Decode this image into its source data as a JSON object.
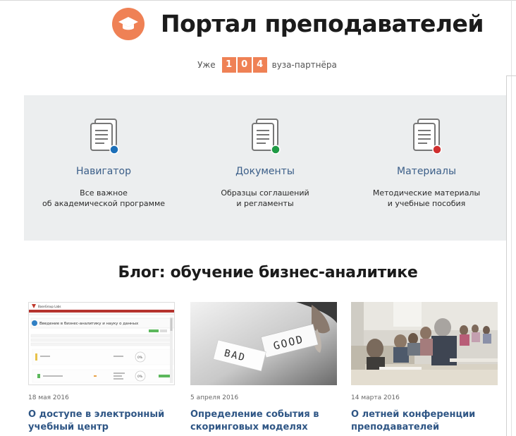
{
  "header": {
    "logo_icon": "graduation-cap-icon",
    "title": "Портал преподавателей",
    "accent_color": "#ef8155"
  },
  "counter": {
    "prefix": "Уже",
    "digits": [
      "1",
      "0",
      "4"
    ],
    "suffix": "вуза-партнёра"
  },
  "features": [
    {
      "icon": "document-icon",
      "dot_color": "#1c6fb8",
      "title": "Навигатор",
      "desc_line1": "Все важное",
      "desc_line2": "об академической программе"
    },
    {
      "icon": "document-icon",
      "dot_color": "#1f9a45",
      "title": "Документы",
      "desc_line1": "Образцы соглашений",
      "desc_line2": "и регламенты"
    },
    {
      "icon": "document-icon",
      "dot_color": "#cf2e2e",
      "title": "Материалы",
      "desc_line1": "Методические материалы",
      "desc_line2": "и учебные пособия"
    }
  ],
  "blog": {
    "title": "Блог: обучение бизнес-аналитике",
    "posts": [
      {
        "date": "18 мая 2016",
        "title_line1": "О доступе в электронный",
        "title_line2": "учебный центр",
        "thumb": "screenshot-thumbnail",
        "thumb_brand": "BaseGroup Labs",
        "thumb_course": "Введение в бизнес-аналитику и науку о данных",
        "thumb_percent": "0%"
      },
      {
        "date": "5 апреля 2016",
        "title_line1": "Определение события в",
        "title_line2": "скоринговых моделях",
        "thumb": "bad-good-cards-photo",
        "thumb_word_left": "BAD",
        "thumb_word_right": "GOOD"
      },
      {
        "date": "14 марта 2016",
        "title_line1": "О летней конференции",
        "title_line2": "преподавателей",
        "thumb": "conference-audience-photo"
      }
    ]
  }
}
